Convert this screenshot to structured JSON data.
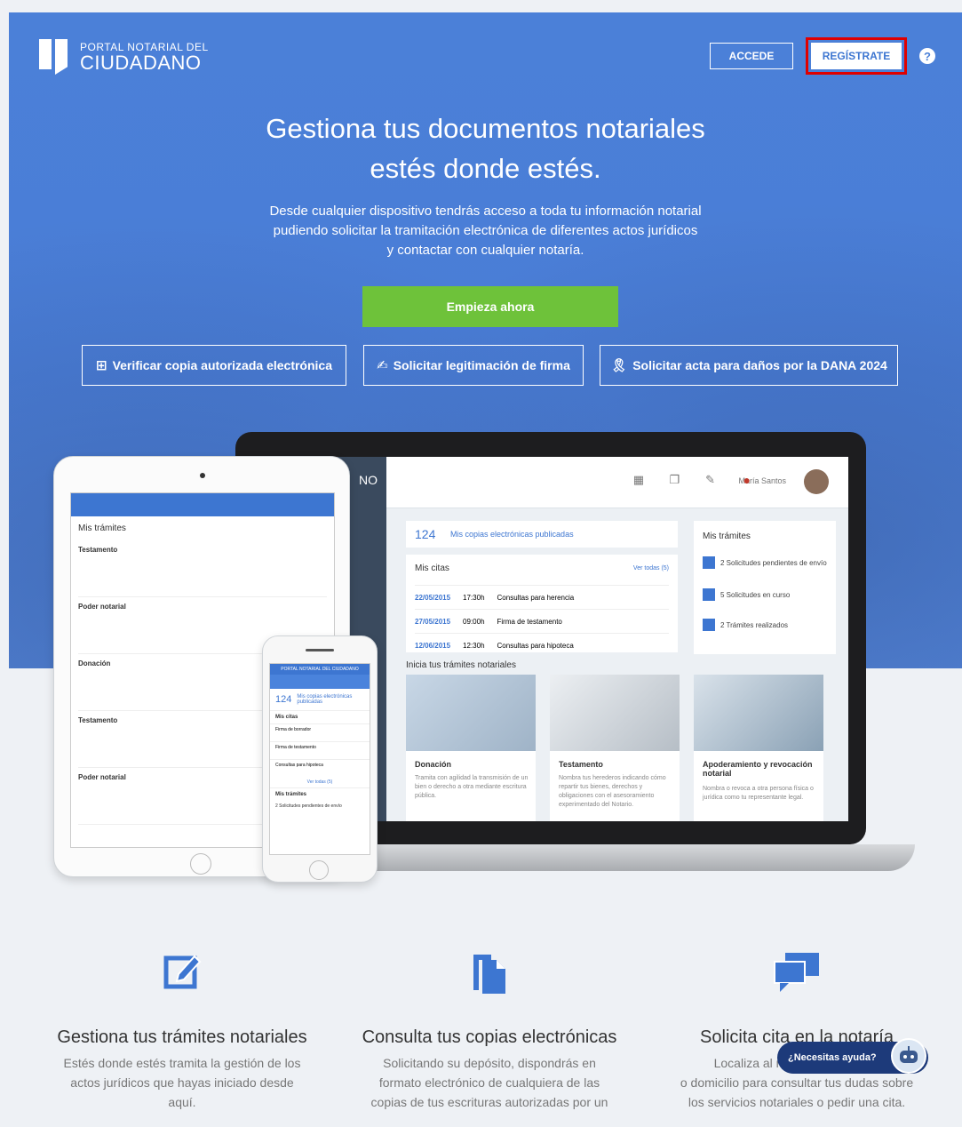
{
  "header": {
    "logo_line1": "PORTAL NOTARIAL DEL",
    "logo_line2": "CIUDADANO",
    "accede_label": "ACCEDE",
    "registrate_label": "REGÍSTRATE",
    "help_label": "?"
  },
  "hero": {
    "title_line1": "Gestiona tus documentos notariales",
    "title_line2": "estés donde estés.",
    "subtitle_line1": "Desde cualquier dispositivo tendrás acceso a toda tu información notarial",
    "subtitle_line2": "pudiendo solicitar la tramitación electrónica de diferentes actos jurídicos",
    "subtitle_line3": "y contactar con cualquier notaría.",
    "cta_label": "Empieza ahora",
    "services": [
      {
        "label": "Verificar copia autorizada electrónica",
        "icon": "qr-icon"
      },
      {
        "label": "Solicitar legitimación de firma",
        "icon": "signature-icon"
      },
      {
        "label": "Solicitar acta para daños por la DANA 2024",
        "icon": "ribbon-icon"
      }
    ]
  },
  "laptop": {
    "user_name": "María Santos",
    "copies_count": "124",
    "copies_label": "Mis copias electrónicas publicadas",
    "citas_title": "Mis citas",
    "citas_link": "Ver todas (5)",
    "citas": [
      {
        "date": "22/05/2015",
        "time": "17:30h",
        "desc": "Consultas para herencia"
      },
      {
        "date": "27/05/2015",
        "time": "09:00h",
        "desc": "Firma de testamento"
      },
      {
        "date": "12/06/2015",
        "time": "12:30h",
        "desc": "Consultas para hipoteca"
      }
    ],
    "tramites_title": "Mis trámites",
    "tramites": [
      {
        "label": "2 Solicitudes pendientes de envío"
      },
      {
        "label": "5 Solicitudes en curso"
      },
      {
        "label": "2 Trámites realizados"
      }
    ],
    "inicia_title": "Inicia tus trámites notariales",
    "tipos": [
      {
        "title": "Donación",
        "desc": "Tramita con agilidad la transmisión de un bien o derecho a otra mediante escritura pública."
      },
      {
        "title": "Testamento",
        "desc": "Nombra tus herederos indicando cómo repartir tus bienes, derechos y obligaciones con el asesoramiento experimentado del Notario."
      },
      {
        "title": "Apoderamiento y revocación notarial",
        "desc": "Nombra o revoca a otra persona física o jurídica como tu representante legal."
      }
    ]
  },
  "tablet": {
    "title": "Mis trámites",
    "items": [
      "Testamento",
      "Poder notarial",
      "Donación",
      "Testamento",
      "Poder notarial"
    ]
  },
  "phone": {
    "header": "PORTAL NOTARIAL DEL CIUDADANO",
    "count": "124",
    "count_label": "Mis copias electrónicas publicadas",
    "citas_title": "Mis citas",
    "citas": [
      "Firma de borrador",
      "Firma de testamento",
      "Consultas para hipoteca"
    ],
    "ver_todas": "Ver todas (5)",
    "tramites_title": "Mis trámites",
    "tramite": "2 Solicitudes pendientes de envío"
  },
  "features": [
    {
      "title": "Gestiona tus trámites notariales",
      "line1": "Estés donde estés tramita la gestión de los",
      "line2": "actos jurídicos que hayas iniciado desde",
      "line3": "aquí.",
      "icon": "edit-icon"
    },
    {
      "title": "Consulta tus copias electrónicas",
      "line1": "Solicitando su depósito, dispondrás en",
      "line2": "formato electrónico de cualquiera de las",
      "line3": "copias de tus escrituras autorizadas por un",
      "icon": "copy-icon"
    },
    {
      "title": "Solicita cita en la notaría",
      "line1": "Localiza al notario m... trabajo",
      "line2": "o domicilio para consultar tus dudas sobre",
      "line3": "los servicios notariales o pedir una cita.",
      "icon": "chat-icon"
    }
  ],
  "chat": {
    "label": "¿Necesitas ayuda?"
  }
}
